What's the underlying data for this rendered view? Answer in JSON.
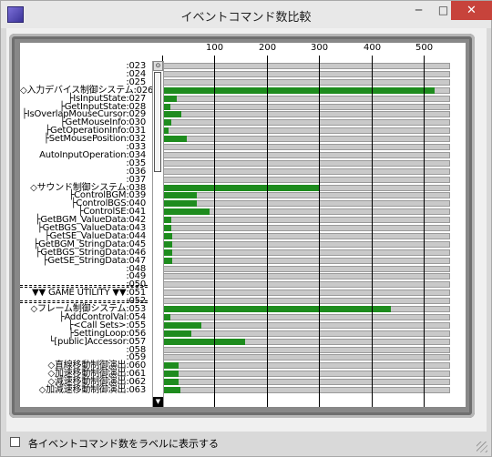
{
  "window": {
    "title": "イベントコマンド数比較",
    "min_label": "─",
    "max_label": "□",
    "close_label": "✕"
  },
  "chart_data": {
    "type": "bar",
    "orientation": "horizontal",
    "x_ticks": [
      "100",
      "200",
      "300",
      "400",
      "500"
    ],
    "xlim": [
      0,
      550
    ],
    "grid": true,
    "categories": [
      ":023",
      ":024",
      ":025",
      "◇入力デバイス制御システム:026",
      "├IsInputState:027",
      "├GetInputState:028",
      "├IsOverlapMouseCursor:029",
      "├GetMouseInfo:030",
      "├GetOperationInfo:031",
      "├SetMousePosition:032",
      ":033",
      "AutoInputOperation:034",
      ":035",
      ":036",
      ":037",
      "◇サウンド制御システム:038",
      "├ControlBGM:039",
      "├ControlBGS:040",
      "├ControlSE:041",
      "├GetBGM_ValueData:042",
      "├GetBGS_ValueData:043",
      "├GetSE_ValueData:044",
      "├GetBGM_StringData:045",
      "├GetBGS_StringData:046",
      "├GetSE_StringData:047",
      ":048",
      ":049",
      ":050",
      "▼▼ GAME UTILITY ▼▼:051",
      ":052",
      "◇フレーム制御システム:053",
      "├AddControlVal:054",
      "├<Call Sets>:055",
      "├SettingLoop:056",
      "└[public]Accessor:057",
      ":058",
      ":059",
      "◇直線移動制御演出:060",
      "◇加速移動制御演出:061",
      "◇減速移動制御演出:062",
      "◇加減速移動制御演出:063"
    ],
    "values": [
      0,
      0,
      0,
      520,
      27,
      15,
      36,
      17,
      13,
      47,
      0,
      0,
      0,
      0,
      0,
      300,
      67,
      67,
      90,
      17,
      17,
      20,
      20,
      20,
      20,
      0,
      0,
      0,
      0,
      0,
      437,
      15,
      74,
      55,
      159,
      0,
      0,
      32,
      32,
      32,
      34
    ]
  },
  "footer": {
    "checkbox_label": "各イベントコマンド数をラベルに表示する",
    "checked": false
  },
  "colors": {
    "bar": "#1e8c1e",
    "track": "#c9c9c9",
    "close_button": "#c7433b"
  }
}
